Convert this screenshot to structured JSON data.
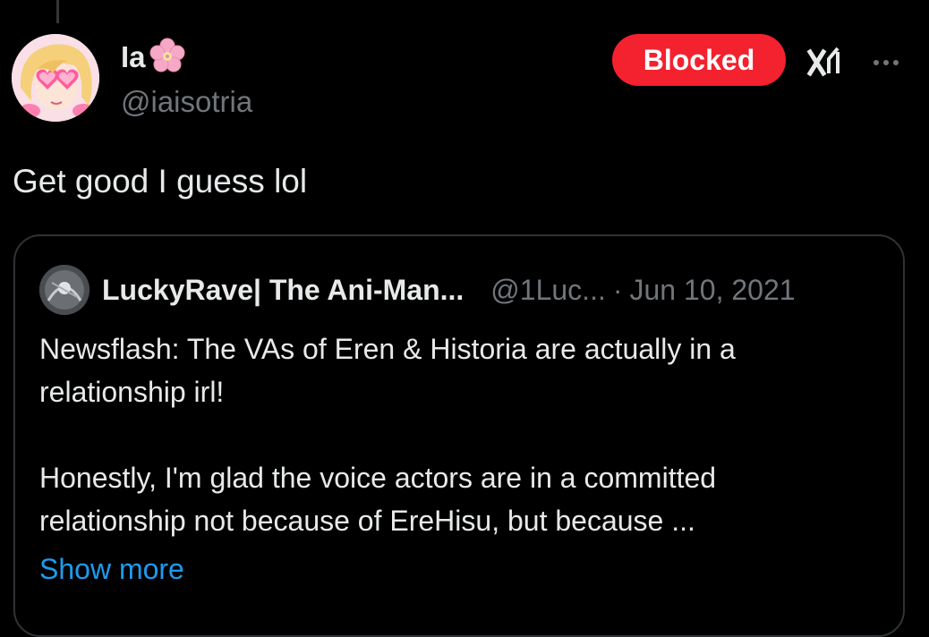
{
  "post": {
    "author_name": "Ia",
    "author_name_emoji": "flower-emoji",
    "author_handle": "@iaisotria",
    "blocked_label": "Blocked",
    "text": "Get good I guess lol",
    "icons": {
      "grok": "grok-icon",
      "more": "more-icon"
    }
  },
  "quote": {
    "author_name": "LuckyRave| The Ani-Man...",
    "author_handle": "@1Luc...",
    "separator": "·",
    "date": "Jun 10, 2021",
    "body_lines": [
      "Newsflash: The VAs of Eren & Historia are actually in a",
      "relationship irl!",
      "Honestly, I'm glad the voice actors are in a committed",
      "relationship not because of EreHisu, but because ..."
    ],
    "show_more_label": "Show more"
  },
  "colors": {
    "background": "#000000",
    "text_primary": "#e7e9ea",
    "text_secondary": "#71767b",
    "blocked_red": "#f4212e",
    "link_blue": "#1d9bf0",
    "border": "#2f3336"
  }
}
